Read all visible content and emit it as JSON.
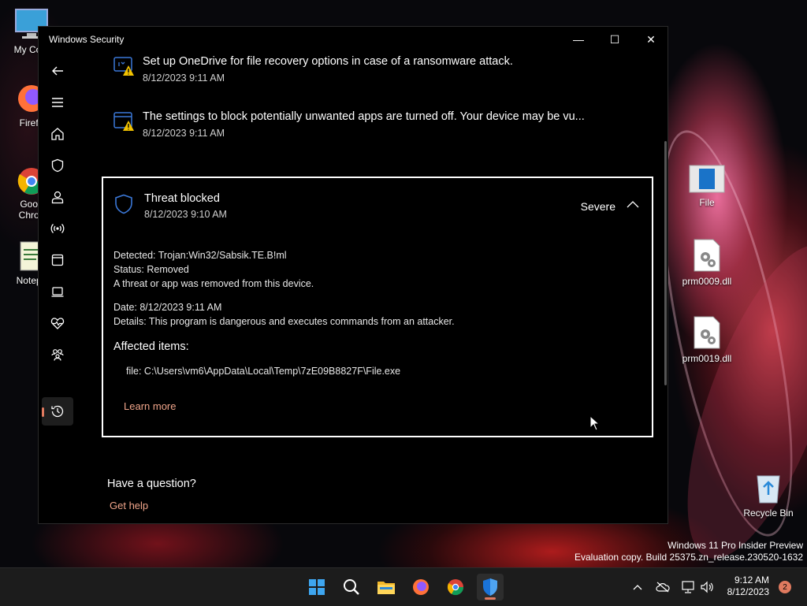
{
  "desktop": {
    "icons": [
      {
        "id": "my-computer",
        "label": "My Com"
      },
      {
        "id": "firefox",
        "label": "Firefo"
      },
      {
        "id": "google-chrome",
        "label1": "Goog",
        "label2": "Chron"
      },
      {
        "id": "notepad",
        "label": "Notepa"
      },
      {
        "id": "file",
        "label": "File"
      },
      {
        "id": "prm0009",
        "label": "prm0009.dll"
      },
      {
        "id": "prm0019",
        "label": "prm0019.dll"
      },
      {
        "id": "recycle-bin",
        "label": "Recycle Bin"
      }
    ],
    "watermark_line1": "Windows 11 Pro Insider Preview",
    "watermark_line2": "Evaluation copy. Build 25375.zn_release.230520-1632"
  },
  "window": {
    "title": "Windows Security",
    "controls": {
      "minimize": "—",
      "maximize": "☐",
      "close": "✕"
    }
  },
  "nav": {
    "items": [
      "back",
      "menu",
      "home",
      "virus-protection",
      "account-protection",
      "firewall-network",
      "app-browser-control",
      "device-security",
      "device-performance",
      "family-options",
      "protection-history",
      "settings"
    ],
    "selected": "protection-history"
  },
  "history": {
    "items": [
      {
        "title": "Set up OneDrive for file recovery options in case of a ransomware attack.",
        "time": "8/12/2023 9:11 AM",
        "icon": "onedrive-warning-icon"
      },
      {
        "title": "The settings to block potentially unwanted apps are turned off. Your device may be vu...",
        "time": "8/12/2023 9:11 AM",
        "icon": "app-warning-icon"
      }
    ],
    "expanded": {
      "title": "Threat blocked",
      "time": "8/12/2023 9:10 AM",
      "severity": "Severe",
      "detected": "Detected:  Trojan:Win32/Sabsik.TE.B!ml",
      "status": "Status:  Removed",
      "status_note": "A threat or app was removed from this device.",
      "date": "Date:  8/12/2023 9:11 AM",
      "details": "Details:  This program is dangerous and executes commands from an attacker.",
      "affected_label": "Affected items:",
      "file": "file: C:\\Users\\vm6\\AppData\\Local\\Temp\\7zE09B8827F\\File.exe",
      "learn_more": "Learn more"
    }
  },
  "help": {
    "question": "Have a question?",
    "link": "Get help"
  },
  "taskbar": {
    "apps": [
      "start",
      "search",
      "file-explorer",
      "firefox",
      "chrome",
      "windows-security"
    ],
    "time": "9:12 AM",
    "date": "8/12/2023",
    "notification_count": "2"
  },
  "colors": {
    "accent": "#e07a5f",
    "link": "#f0a58a",
    "shield": "#3b78d8"
  }
}
